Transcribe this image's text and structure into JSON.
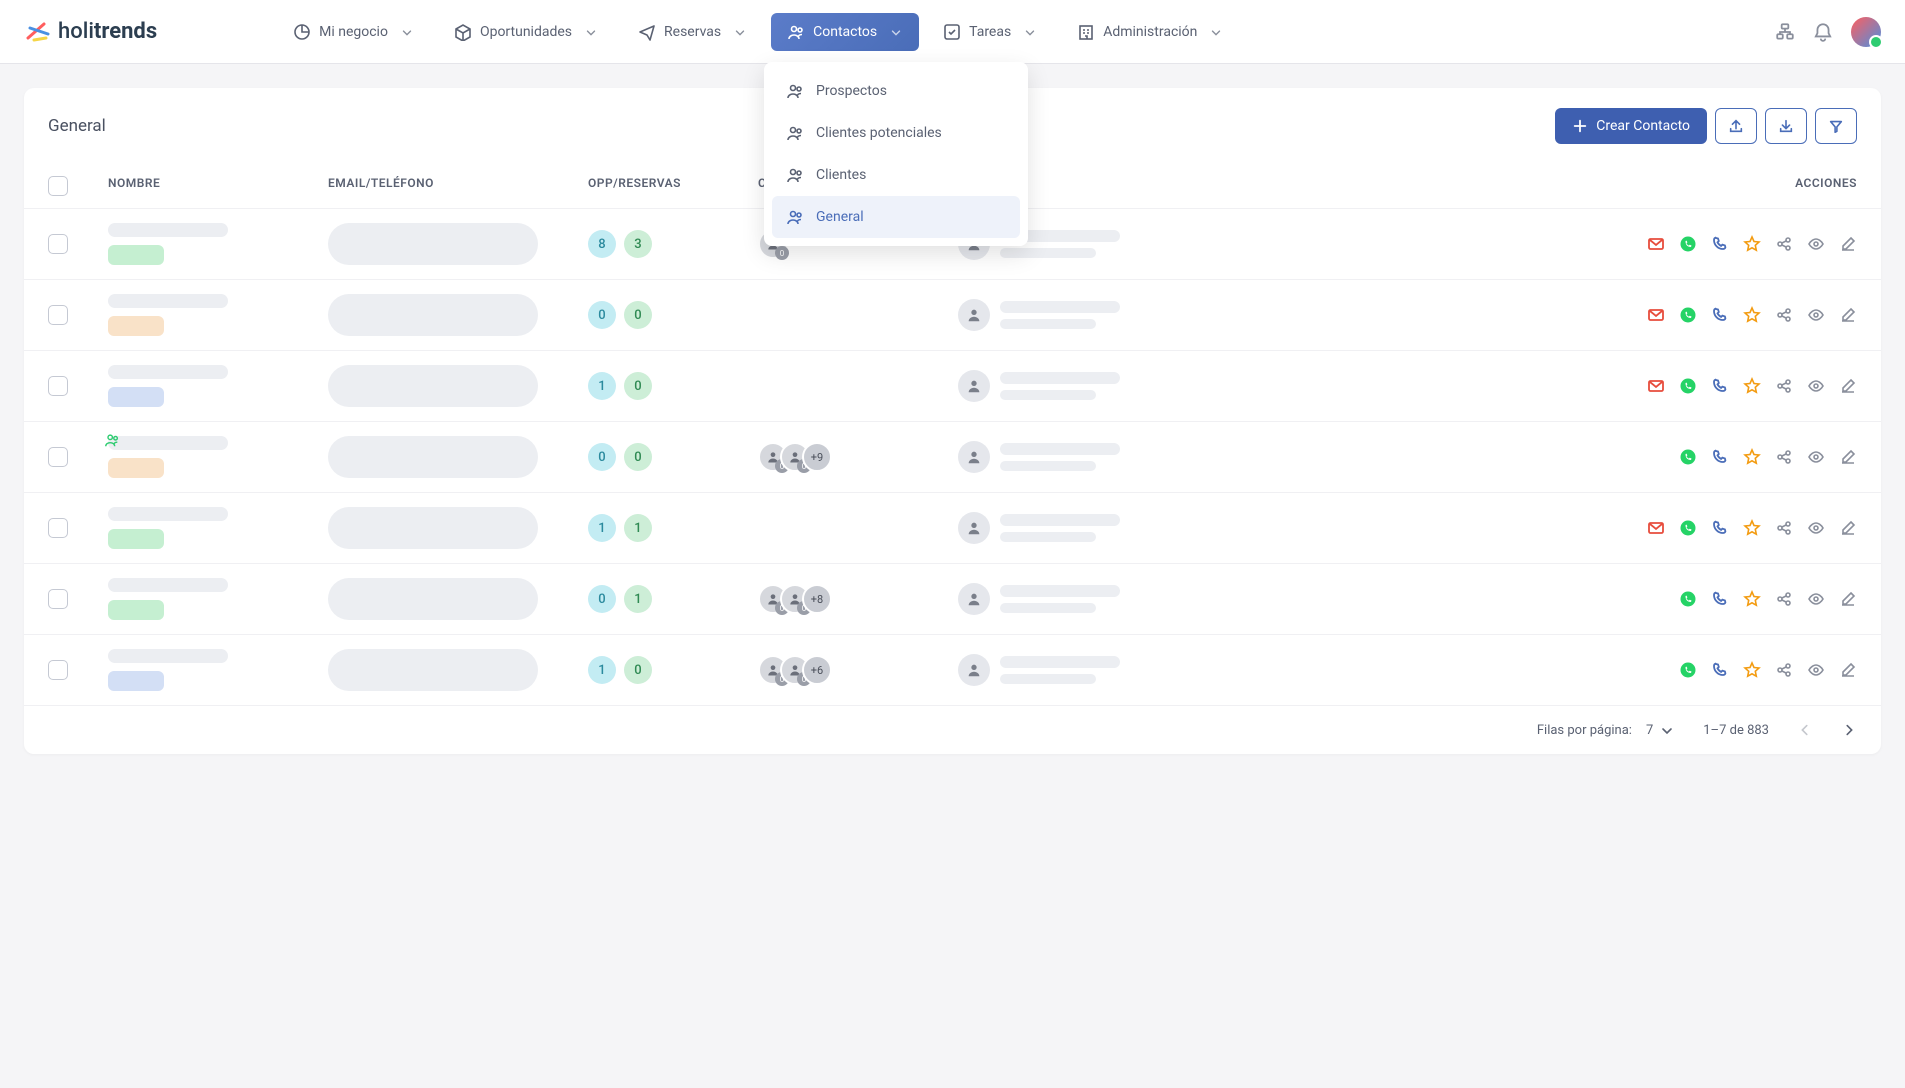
{
  "brand": {
    "name_thin": "holi",
    "name_bold": "trends"
  },
  "nav": {
    "items": [
      {
        "label": "Mi negocio"
      },
      {
        "label": "Oportunidades"
      },
      {
        "label": "Reservas"
      },
      {
        "label": "Contactos",
        "active": true
      },
      {
        "label": "Tareas"
      },
      {
        "label": "Administración"
      }
    ]
  },
  "dropdown": {
    "items": [
      {
        "label": "Prospectos"
      },
      {
        "label": "Clientes potenciales"
      },
      {
        "label": "Clientes"
      },
      {
        "label": "General",
        "active": true
      }
    ]
  },
  "page": {
    "title": "General",
    "create_label": "Crear Contacto"
  },
  "columns": {
    "name": "NOMBRE",
    "email": "EMAIL/TELÉFONO",
    "opp": "OPP/RESERVAS",
    "shared": "COMPARTID...",
    "actions": "ACCIONES"
  },
  "rows": [
    {
      "tag": "green",
      "opp": "8",
      "res": "3",
      "shared": [
        {
          "sub": "0"
        }
      ],
      "plus": "",
      "email": true,
      "lead": false
    },
    {
      "tag": "orange",
      "opp": "0",
      "res": "0",
      "shared": [],
      "plus": "",
      "email": true,
      "lead": false
    },
    {
      "tag": "blue",
      "opp": "1",
      "res": "0",
      "shared": [],
      "plus": "",
      "email": true,
      "lead": false
    },
    {
      "tag": "orange",
      "opp": "0",
      "res": "0",
      "shared": [
        {
          "sub": "0"
        },
        {
          "sub": "0"
        }
      ],
      "plus": "+9",
      "email": false,
      "lead": true
    },
    {
      "tag": "green",
      "opp": "1",
      "res": "1",
      "shared": [],
      "plus": "",
      "email": true,
      "lead": false
    },
    {
      "tag": "green",
      "opp": "0",
      "res": "1",
      "shared": [
        {
          "sub": "0"
        },
        {
          "sub": "0"
        }
      ],
      "plus": "+8",
      "email": false,
      "lead": false
    },
    {
      "tag": "blue",
      "opp": "1",
      "res": "0",
      "shared": [
        {
          "sub": "0"
        },
        {
          "sub": "0"
        }
      ],
      "plus": "+6",
      "email": false,
      "lead": false
    }
  ],
  "pagination": {
    "rows_label": "Filas por página:",
    "per_page": "7",
    "range": "1–7 de 883"
  }
}
